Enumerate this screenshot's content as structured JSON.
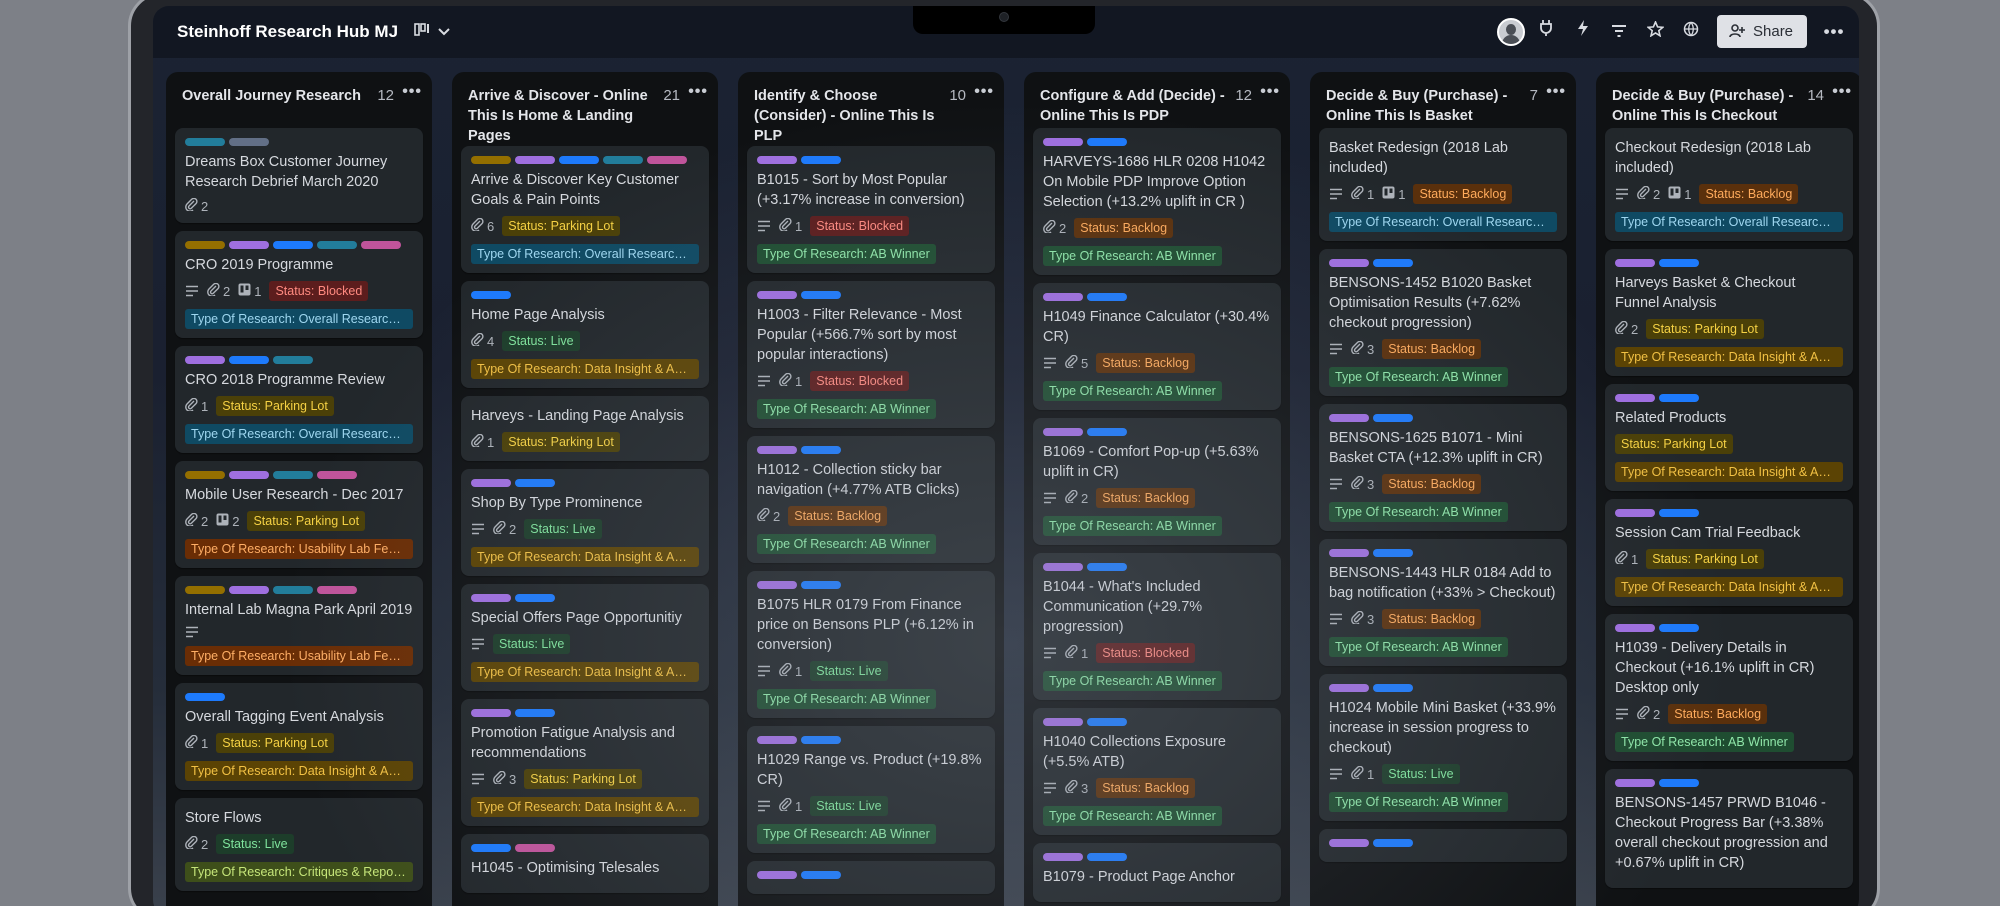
{
  "board": {
    "title": "Steinhoff Research Hub MJ"
  },
  "header": {
    "share_label": "Share",
    "icons": [
      "board-view-icon",
      "chevron-down-icon",
      "power-up-icon",
      "automation-icon",
      "filter-icon",
      "star-icon",
      "globe-icon",
      "more-icon"
    ]
  },
  "colors": {
    "green": "#4bce97",
    "yellow": "#c6a200",
    "olive": "#946f00",
    "orange": "#e2742f",
    "red": "#c9372c",
    "purple": "#9f6fe0",
    "blue": "#1d7afc",
    "teal": "#227d9b",
    "pink": "#c0549b",
    "gray": "#626f86"
  },
  "lists": [
    {
      "title": "Overall Journey Research",
      "count": "12",
      "cards": [
        {
          "labels": [
            "teal",
            "gray"
          ],
          "title": "Dreams Box Customer Journey Research Debrief March 2020",
          "attachments": "2"
        },
        {
          "labels": [
            "olive",
            "purple",
            "blue",
            "teal",
            "pink"
          ],
          "title": "CRO 2019 Programme",
          "description": true,
          "attachments": "2",
          "trello": "1",
          "status": "Status: Blocked",
          "status_kind": "blocked",
          "type": "Type Of Research: Overall Research Review",
          "type_kind": "overall"
        },
        {
          "labels": [
            "purple",
            "blue",
            "teal"
          ],
          "title": "CRO 2018 Programme Review",
          "attachments": "1",
          "status": "Status: Parking Lot",
          "status_kind": "parking",
          "type": "Type Of Research: Overall Research Review",
          "type_kind": "overall"
        },
        {
          "labels": [
            "olive",
            "purple",
            "teal",
            "pink"
          ],
          "title": "Mobile User Research - Dec 2017",
          "attachments": "2",
          "trello": "2",
          "status": "Status: Parking Lot",
          "status_kind": "parking",
          "type": "Type Of Research: Usability Lab Feedback",
          "type_kind": "usab"
        },
        {
          "labels": [
            "olive",
            "purple",
            "teal",
            "pink"
          ],
          "title": "Internal Lab Magna Park April 2019",
          "description": true,
          "type": "Type Of Research: Usability Lab Feedback",
          "type_kind": "usab"
        },
        {
          "labels": [
            "blue"
          ],
          "title": "Overall Tagging Event Analysis",
          "attachments": "1",
          "status": "Status: Parking Lot",
          "status_kind": "parking",
          "type": "Type Of Research: Data Insight & Analysis",
          "type_kind": "data"
        },
        {
          "labels": [],
          "title": "Store Flows",
          "attachments": "2",
          "status": "Status: Live",
          "status_kind": "live",
          "type": "Type Of Research: Critiques & Reports",
          "type_kind": "crit"
        }
      ]
    },
    {
      "title": "Arrive & Discover - Online This Is Home & Landing Pages",
      "count": "21",
      "cards": [
        {
          "labels": [
            "olive",
            "purple",
            "blue",
            "teal",
            "pink"
          ],
          "title": "Arrive & Discover Key Customer Goals & Pain Points",
          "attachments": "6",
          "status": "Status: Parking Lot",
          "status_kind": "parking",
          "type": "Type Of Research: Overall Research Review",
          "type_kind": "overall"
        },
        {
          "labels": [
            "blue"
          ],
          "title": "Home Page Analysis",
          "attachments": "4",
          "status": "Status: Live",
          "status_kind": "live",
          "type": "Type Of Research: Data Insight & Analysis",
          "type_kind": "data"
        },
        {
          "labels": [],
          "title": "Harveys - Landing Page Analysis",
          "attachments": "1",
          "status": "Status: Parking Lot",
          "status_kind": "parking"
        },
        {
          "labels": [
            "purple",
            "blue"
          ],
          "title": "Shop By Type Prominence",
          "description": true,
          "attachments": "2",
          "status": "Status: Live",
          "status_kind": "live",
          "type": "Type Of Research: Data Insight & Analysis",
          "type_kind": "data"
        },
        {
          "labels": [
            "purple",
            "blue"
          ],
          "title": "Special Offers Page Opportunitiy",
          "description": true,
          "status": "Status: Live",
          "status_kind": "live",
          "type": "Type Of Research: Data Insight & Analysis",
          "type_kind": "data"
        },
        {
          "labels": [
            "purple",
            "blue"
          ],
          "title": "Promotion Fatigue Analysis and recommendations",
          "description": true,
          "attachments": "3",
          "status": "Status: Parking Lot",
          "status_kind": "parking",
          "type": "Type Of Research: Data Insight & Analysis",
          "type_kind": "data"
        },
        {
          "labels": [
            "blue",
            "pink"
          ],
          "title": "H1045 - Optimising Telesales"
        }
      ]
    },
    {
      "title": "Identify & Choose (Consider) - Online This Is PLP",
      "count": "10",
      "cards": [
        {
          "labels": [
            "purple",
            "blue"
          ],
          "title": "B1015 - Sort by Most Popular (+3.17% increase in conversion)",
          "description": true,
          "attachments": "1",
          "status": "Status: Blocked",
          "status_kind": "blocked",
          "type": "Type Of Research: AB Winner",
          "type_kind": "ab"
        },
        {
          "labels": [
            "purple",
            "blue"
          ],
          "title": "H1003 - Filter Relevance - Most Popular (+566.7% sort by most popular interactions)",
          "description": true,
          "attachments": "1",
          "status": "Status: Blocked",
          "status_kind": "blocked",
          "type": "Type Of Research: AB Winner",
          "type_kind": "ab"
        },
        {
          "labels": [
            "purple",
            "blue"
          ],
          "title": "H1012 - Collection sticky bar navigation (+4.77% ATB Clicks)",
          "attachments": "2",
          "status": "Status: Backlog",
          "status_kind": "backlog",
          "type": "Type Of Research: AB Winner",
          "type_kind": "ab"
        },
        {
          "labels": [
            "purple",
            "blue"
          ],
          "title": "B1075 HLR 0179 From Finance price on Bensons PLP (+6.12% in conversion)",
          "description": true,
          "attachments": "1",
          "status": "Status: Live",
          "status_kind": "live",
          "type": "Type Of Research: AB Winner",
          "type_kind": "ab"
        },
        {
          "labels": [
            "purple",
            "blue"
          ],
          "title": "H1029 Range vs. Product (+19.8% CR)",
          "description": true,
          "attachments": "1",
          "status": "Status: Live",
          "status_kind": "live",
          "type": "Type Of Research: AB Winner",
          "type_kind": "ab"
        },
        {
          "labels": [
            "purple",
            "blue"
          ],
          "title": ""
        }
      ]
    },
    {
      "title": "Configure & Add (Decide) - Online This Is PDP",
      "count": "12",
      "cards": [
        {
          "labels": [
            "purple",
            "blue"
          ],
          "title": "HARVEYS-1686 HLR 0208 H1042 On Mobile PDP Improve Option Selection (+13.2% uplift in CR )",
          "attachments": "2",
          "status": "Status: Backlog",
          "status_kind": "backlog",
          "type": "Type Of Research: AB Winner",
          "type_kind": "ab"
        },
        {
          "labels": [
            "purple",
            "blue"
          ],
          "title": "H1049 Finance Calculator (+30.4% CR)",
          "description": true,
          "attachments": "5",
          "status": "Status: Backlog",
          "status_kind": "backlog",
          "type": "Type Of Research: AB Winner",
          "type_kind": "ab"
        },
        {
          "labels": [
            "purple",
            "blue"
          ],
          "title": "B1069 - Comfort Pop-up (+5.63% uplift in CR)",
          "description": true,
          "attachments": "2",
          "status": "Status: Backlog",
          "status_kind": "backlog",
          "type": "Type Of Research: AB Winner",
          "type_kind": "ab"
        },
        {
          "labels": [
            "purple",
            "blue"
          ],
          "title": "B1044 - What's Included Communication (+29.7% progression)",
          "description": true,
          "attachments": "1",
          "status": "Status: Blocked",
          "status_kind": "blocked",
          "type": "Type Of Research: AB Winner",
          "type_kind": "ab"
        },
        {
          "labels": [
            "purple",
            "blue"
          ],
          "title": "H1040 Collections Exposure (+5.5% ATB)",
          "description": true,
          "attachments": "3",
          "status": "Status: Backlog",
          "status_kind": "backlog",
          "type": "Type Of Research: AB Winner",
          "type_kind": "ab"
        },
        {
          "labels": [
            "purple",
            "blue"
          ],
          "title": "B1079 - Product Page Anchor"
        }
      ]
    },
    {
      "title": "Decide & Buy (Purchase) - Online This Is Basket",
      "count": "7",
      "cards": [
        {
          "labels": [],
          "title": "Basket Redesign (2018 Lab included)",
          "description": true,
          "attachments": "1",
          "trello": "1",
          "status": "Status: Backlog",
          "status_kind": "backlog",
          "type": "Type Of Research: Overall Research Review",
          "type_kind": "overall"
        },
        {
          "labels": [
            "purple",
            "blue"
          ],
          "title": "BENSONS-1452 B1020 Basket Optimisation Results (+7.62% checkout progression)",
          "description": true,
          "attachments": "3",
          "status": "Status: Backlog",
          "status_kind": "backlog",
          "type": "Type Of Research: AB Winner",
          "type_kind": "ab"
        },
        {
          "labels": [
            "purple",
            "blue"
          ],
          "title": "BENSONS-1625 B1071 - Mini Basket CTA (+12.3% uplift in CR)",
          "description": true,
          "attachments": "3",
          "status": "Status: Backlog",
          "status_kind": "backlog",
          "type": "Type Of Research: AB Winner",
          "type_kind": "ab"
        },
        {
          "labels": [
            "purple",
            "blue"
          ],
          "title": "BENSONS-1443 HLR 0184 Add to bag notification (+33% > Checkout)",
          "description": true,
          "attachments": "3",
          "status": "Status: Backlog",
          "status_kind": "backlog",
          "type": "Type Of Research: AB Winner",
          "type_kind": "ab"
        },
        {
          "labels": [
            "purple",
            "blue"
          ],
          "title": "H1024 Mobile Mini Basket (+33.9% increase in session progress to checkout)",
          "description": true,
          "attachments": "1",
          "status": "Status: Live",
          "status_kind": "live",
          "type": "Type Of Research: AB Winner",
          "type_kind": "ab"
        },
        {
          "labels": [
            "purple",
            "blue"
          ],
          "title": ""
        }
      ]
    },
    {
      "title": "Decide & Buy (Purchase) - Online This Is Checkout",
      "count": "14",
      "cards": [
        {
          "labels": [],
          "title": "Checkout Redesign (2018 Lab included)",
          "description": true,
          "attachments": "2",
          "trello": "1",
          "status": "Status: Backlog",
          "status_kind": "backlog",
          "type": "Type Of Research: Overall Research Review",
          "type_kind": "overall"
        },
        {
          "labels": [
            "purple",
            "blue"
          ],
          "title": "Harveys Basket & Checkout Funnel Analysis",
          "attachments": "2",
          "status": "Status: Parking Lot",
          "status_kind": "parking",
          "type": "Type Of Research: Data Insight & Analysis",
          "type_kind": "data"
        },
        {
          "labels": [
            "purple",
            "blue"
          ],
          "title": "Related Products",
          "status": "Status: Parking Lot",
          "status_kind": "parking",
          "type": "Type Of Research: Data Insight & Analysis",
          "type_kind": "data"
        },
        {
          "labels": [
            "purple",
            "blue"
          ],
          "title": "Session Cam Trial Feedback",
          "attachments": "1",
          "status": "Status: Parking Lot",
          "status_kind": "parking",
          "type": "Type Of Research: Data Insight & Analysis",
          "type_kind": "data"
        },
        {
          "labels": [
            "purple",
            "blue"
          ],
          "title": "H1039 - Delivery Details in Checkout (+16.1% uplift in CR) Desktop only",
          "description": true,
          "attachments": "2",
          "status": "Status: Backlog",
          "status_kind": "backlog",
          "type": "Type Of Research: AB Winner",
          "type_kind": "ab"
        },
        {
          "labels": [
            "purple",
            "blue"
          ],
          "title": "BENSONS-1457 PRWD B1046 - Checkout Progress Bar (+3.38% overall checkout progression and +0.67% uplift in CR)"
        }
      ]
    }
  ]
}
